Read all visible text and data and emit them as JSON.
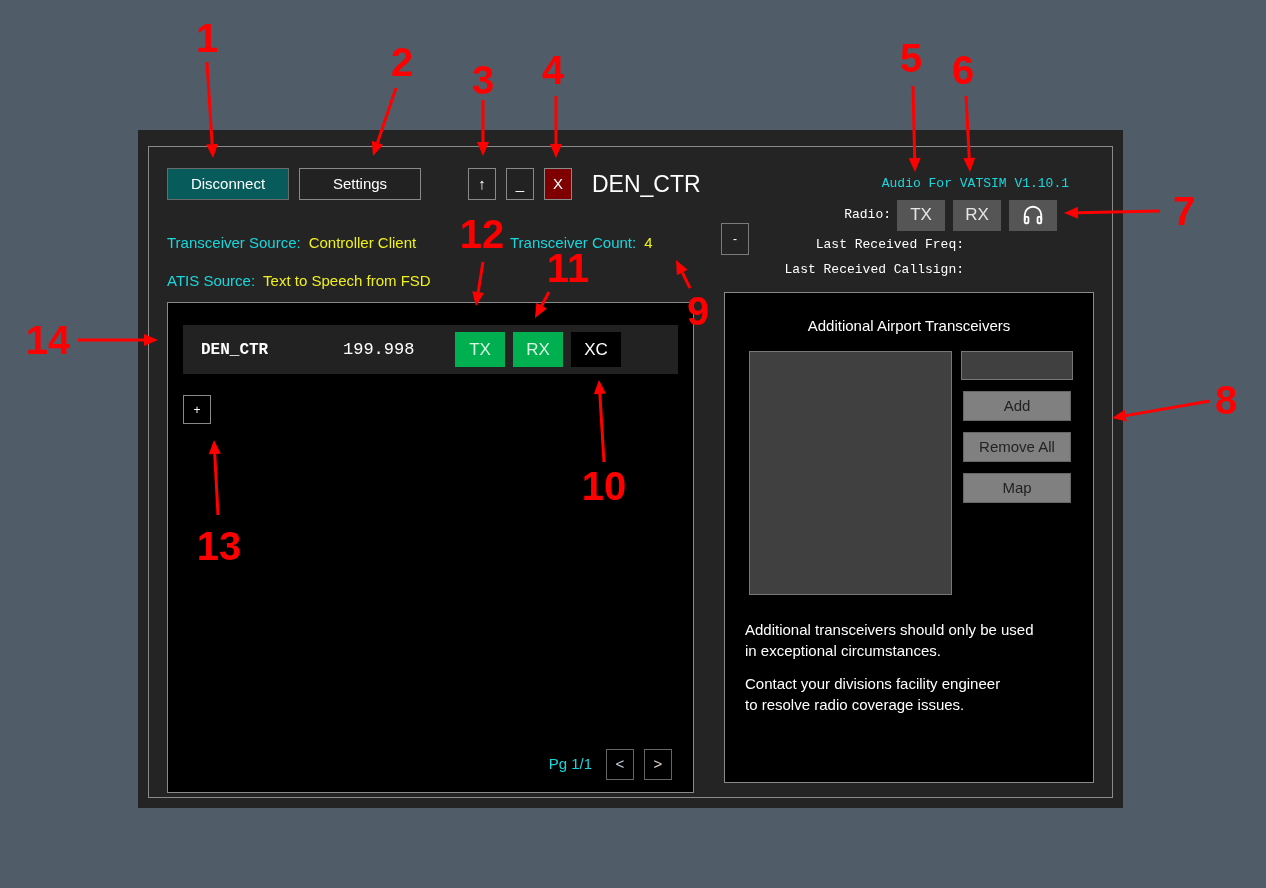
{
  "toolbar": {
    "buttons": [
      {
        "label": "Disconnect",
        "kind": "connect"
      },
      {
        "label": "Settings",
        "kind": "wide"
      },
      {
        "label": "↑",
        "kind": "small"
      },
      {
        "label": "_",
        "kind": "small"
      },
      {
        "label": "X",
        "kind": "close"
      }
    ]
  },
  "window": {
    "title": "DEN_CTR"
  },
  "version": "Audio For VATSIM V1.10.1",
  "radio": {
    "label": "Radio:",
    "buttons": [
      {
        "label": "TX",
        "kind": "text",
        "on": false
      },
      {
        "label": "RX",
        "kind": "text",
        "on": false
      },
      {
        "kind": "headphones",
        "on": false
      }
    ]
  },
  "info_rows": [
    [
      {
        "label": "Transceiver Source:",
        "value": "Controller Client"
      },
      {
        "label": "Transceiver Count:",
        "value": "4"
      }
    ],
    [
      {
        "label": "ATIS Source:",
        "value": "Text to Speech from FSD"
      }
    ]
  ],
  "collapse_button": "-",
  "last_received": [
    {
      "label": "Last Received Freq:"
    },
    {
      "label": "Last Received Callsign:"
    }
  ],
  "stations": [
    {
      "callsign": "DEN_CTR",
      "frequency": "199.998",
      "toggles": [
        {
          "label": "TX",
          "on": true
        },
        {
          "label": "RX",
          "on": true
        },
        {
          "label": "XC",
          "on": false
        }
      ]
    }
  ],
  "add_button": "+",
  "pager": {
    "text": "Pg 1/1",
    "prev": "<",
    "next": ">"
  },
  "airport_panel": {
    "title": "Additional Airport Transceivers",
    "buttons": [
      "Add",
      "Remove All",
      "Map"
    ],
    "notes": [
      {
        "lines": [
          "Additional transceivers should only be used",
          "in exceptional circumstances."
        ]
      },
      {
        "lines": [
          "Contact your divisions facility engineer",
          "to resolve radio coverage issues."
        ]
      }
    ]
  },
  "annotations": [
    {
      "label": "1"
    },
    {
      "label": "2"
    },
    {
      "label": "3"
    },
    {
      "label": "4"
    },
    {
      "label": "5"
    },
    {
      "label": "6"
    },
    {
      "label": "7"
    },
    {
      "label": "8"
    },
    {
      "label": "9"
    },
    {
      "label": "10"
    },
    {
      "label": "11"
    },
    {
      "label": "12"
    },
    {
      "label": "13"
    },
    {
      "label": "14"
    }
  ]
}
